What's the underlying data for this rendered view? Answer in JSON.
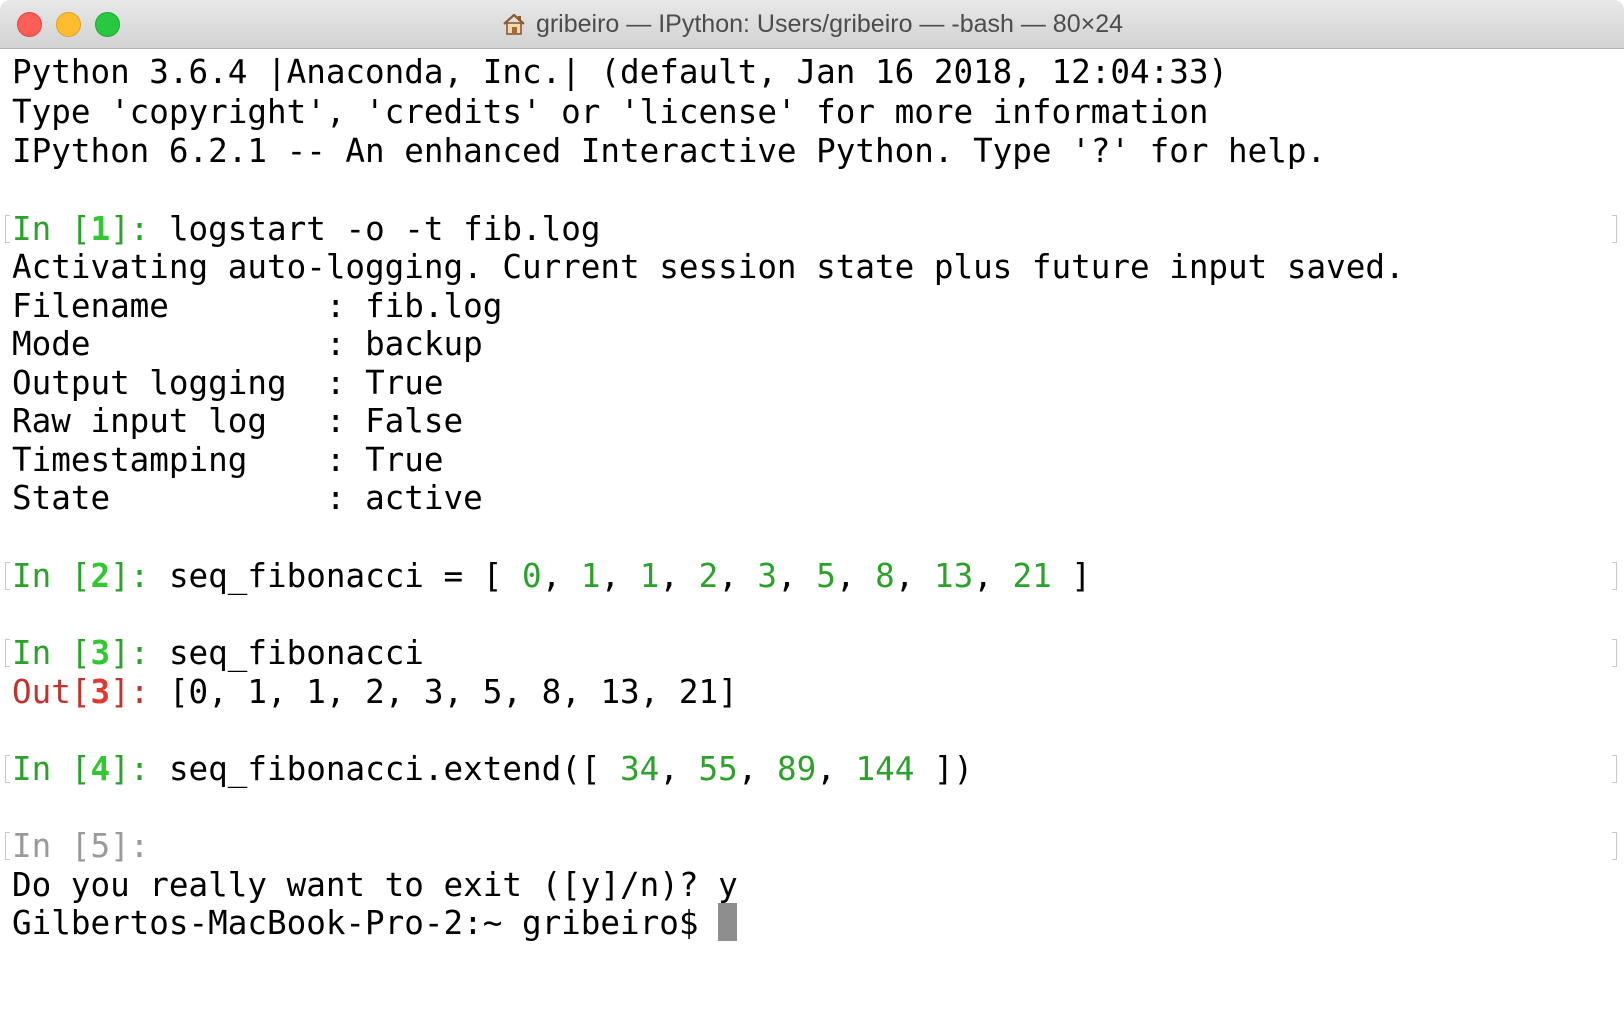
{
  "window": {
    "title": "gribeiro — IPython: Users/gribeiro — -bash — 80×24"
  },
  "terminal": {
    "banner": [
      "Python 3.6.4 |Anaconda, Inc.| (default, Jan 16 2018, 12:04:33)",
      "Type 'copyright', 'credits' or 'license' for more information",
      "IPython 6.2.1 -- An enhanced Interactive Python. Type '?' for help."
    ],
    "cells": [
      {
        "prompt_in": "In [",
        "number": "1",
        "prompt_close": "]: ",
        "code": "logstart -o -t fib.log"
      },
      {
        "prompt_in": "In [",
        "number": "2",
        "prompt_close": "]: ",
        "code_prefix": "seq_fibonacci = [ ",
        "numbers": [
          "0",
          "1",
          "1",
          "2",
          "3",
          "5",
          "8",
          "13",
          "21"
        ],
        "code_suffix": " ]"
      },
      {
        "prompt_in": "In [",
        "number": "3",
        "prompt_close": "]: ",
        "code": "seq_fibonacci",
        "out_prompt": "Out[",
        "out_number": "3",
        "out_close": "]: ",
        "output": "[0, 1, 1, 2, 3, 5, 8, 13, 21]"
      },
      {
        "prompt_in": "In [",
        "number": "4",
        "prompt_close": "]: ",
        "code_prefix": "seq_fibonacci.extend([ ",
        "numbers": [
          "34",
          "55",
          "89",
          "144"
        ],
        "code_suffix": " ])"
      },
      {
        "prompt": "In [5]: "
      }
    ],
    "log_message": "Activating auto-logging. Current session state plus future input saved.",
    "log_settings": [
      {
        "key": "Filename        ",
        "value": "fib.log"
      },
      {
        "key": "Mode            ",
        "value": "backup"
      },
      {
        "key": "Output logging  ",
        "value": "True"
      },
      {
        "key": "Raw input log   ",
        "value": "False"
      },
      {
        "key": "Timestamping    ",
        "value": "True"
      },
      {
        "key": "State           ",
        "value": "active"
      }
    ],
    "exit_prompt": "Do you really want to exit ([y]/n)? y",
    "shell_prompt": "Gilbertos-MacBook-Pro-2:~ gribeiro$ "
  },
  "colors": {
    "prompt_in": "#2ca12c",
    "prompt_in_number": "#32c832",
    "prompt_out": "#c0332e",
    "prompt_out_number": "#e03a30",
    "number_literal": "#2ca12c",
    "inactive_prompt": "#9a9a9a",
    "cursor": "#8e8e8e"
  },
  "icons": {
    "title_icon": "home-icon"
  }
}
